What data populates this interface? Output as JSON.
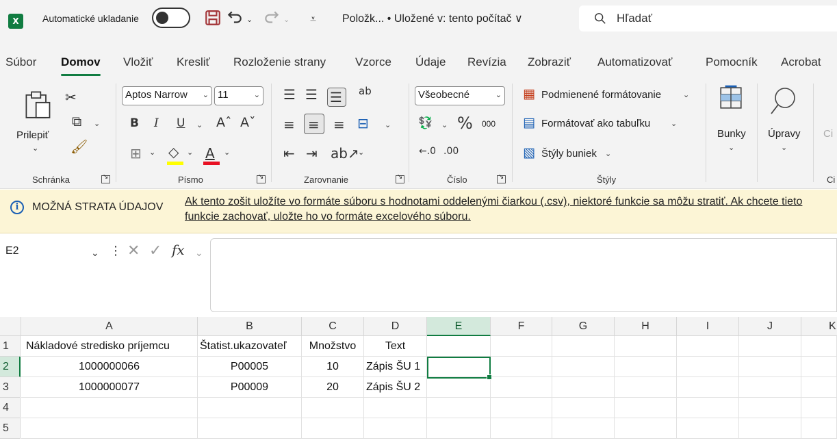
{
  "titlebar": {
    "app_icon": "X",
    "autosave_label": "Automatické ukladanie",
    "doc_title": "Položk... • Uložené v: tento počítač ∨",
    "search_placeholder": "Hľadať",
    "icons": [
      "save-icon",
      "undo-icon",
      "redo-icon",
      "customize-quick-access-icon",
      "search-icon"
    ]
  },
  "tabs": [
    "Súbor",
    "Domov",
    "Vložiť",
    "Kresliť",
    "Rozloženie strany",
    "Vzorce",
    "Údaje",
    "Revízia",
    "Zobraziť",
    "Automatizovať",
    "Pomocník",
    "Acrobat"
  ],
  "active_tab": "Domov",
  "ribbon": {
    "clipboard": {
      "paste_label": "Prilepiť",
      "group_label": "Schránka"
    },
    "font": {
      "font_name": "Aptos Narrow",
      "font_size": "11",
      "group_label": "Písmo"
    },
    "alignment": {
      "group_label": "Zarovnanie"
    },
    "number": {
      "format": "Všeobecné",
      "thousands": "000",
      "group_label": "Číslo"
    },
    "styles": {
      "conditional": "Podmienené formátovanie",
      "as_table": "Formátovať ako tabuľku",
      "cell_styles": "Štýly buniek",
      "group_label": "Štýly"
    },
    "cells": {
      "label": "Bunky"
    },
    "editing": {
      "label": "Úpravy"
    },
    "cut_off_label": "Ci"
  },
  "infobar": {
    "title": "MOŽNÁ STRATA ÚDAJOV",
    "message": "Ak tento zošit uložíte vo formáte súboru s hodnotami oddelenými čiarkou (.csv), niektoré funkcie sa môžu stratiť. Ak chcete tieto funkcie zachovať, uložte ho vo formáte excelového súboru."
  },
  "formula_bar": {
    "name_box": "E2",
    "fx": "fx",
    "value": ""
  },
  "sheet": {
    "columns": [
      "A",
      "B",
      "C",
      "D",
      "E",
      "F",
      "G",
      "H",
      "I",
      "J",
      "K"
    ],
    "rows": [
      "1",
      "2",
      "3",
      "4",
      "5"
    ],
    "selected_cell": "E2",
    "header_row": [
      "Nákladové stredisko príjemcu",
      "Štatist.ukazovateľ",
      "Množstvo",
      "Text"
    ],
    "data": [
      [
        "1000000066",
        "P00005",
        "10",
        "Zápis ŠU 1"
      ],
      [
        "1000000077",
        "P00009",
        "20",
        "Zápis ŠU 2"
      ]
    ]
  },
  "colors": {
    "accent": "#107c41",
    "infobar_bg": "#fcf5d6",
    "chrome_bg": "#f3f3f3"
  }
}
